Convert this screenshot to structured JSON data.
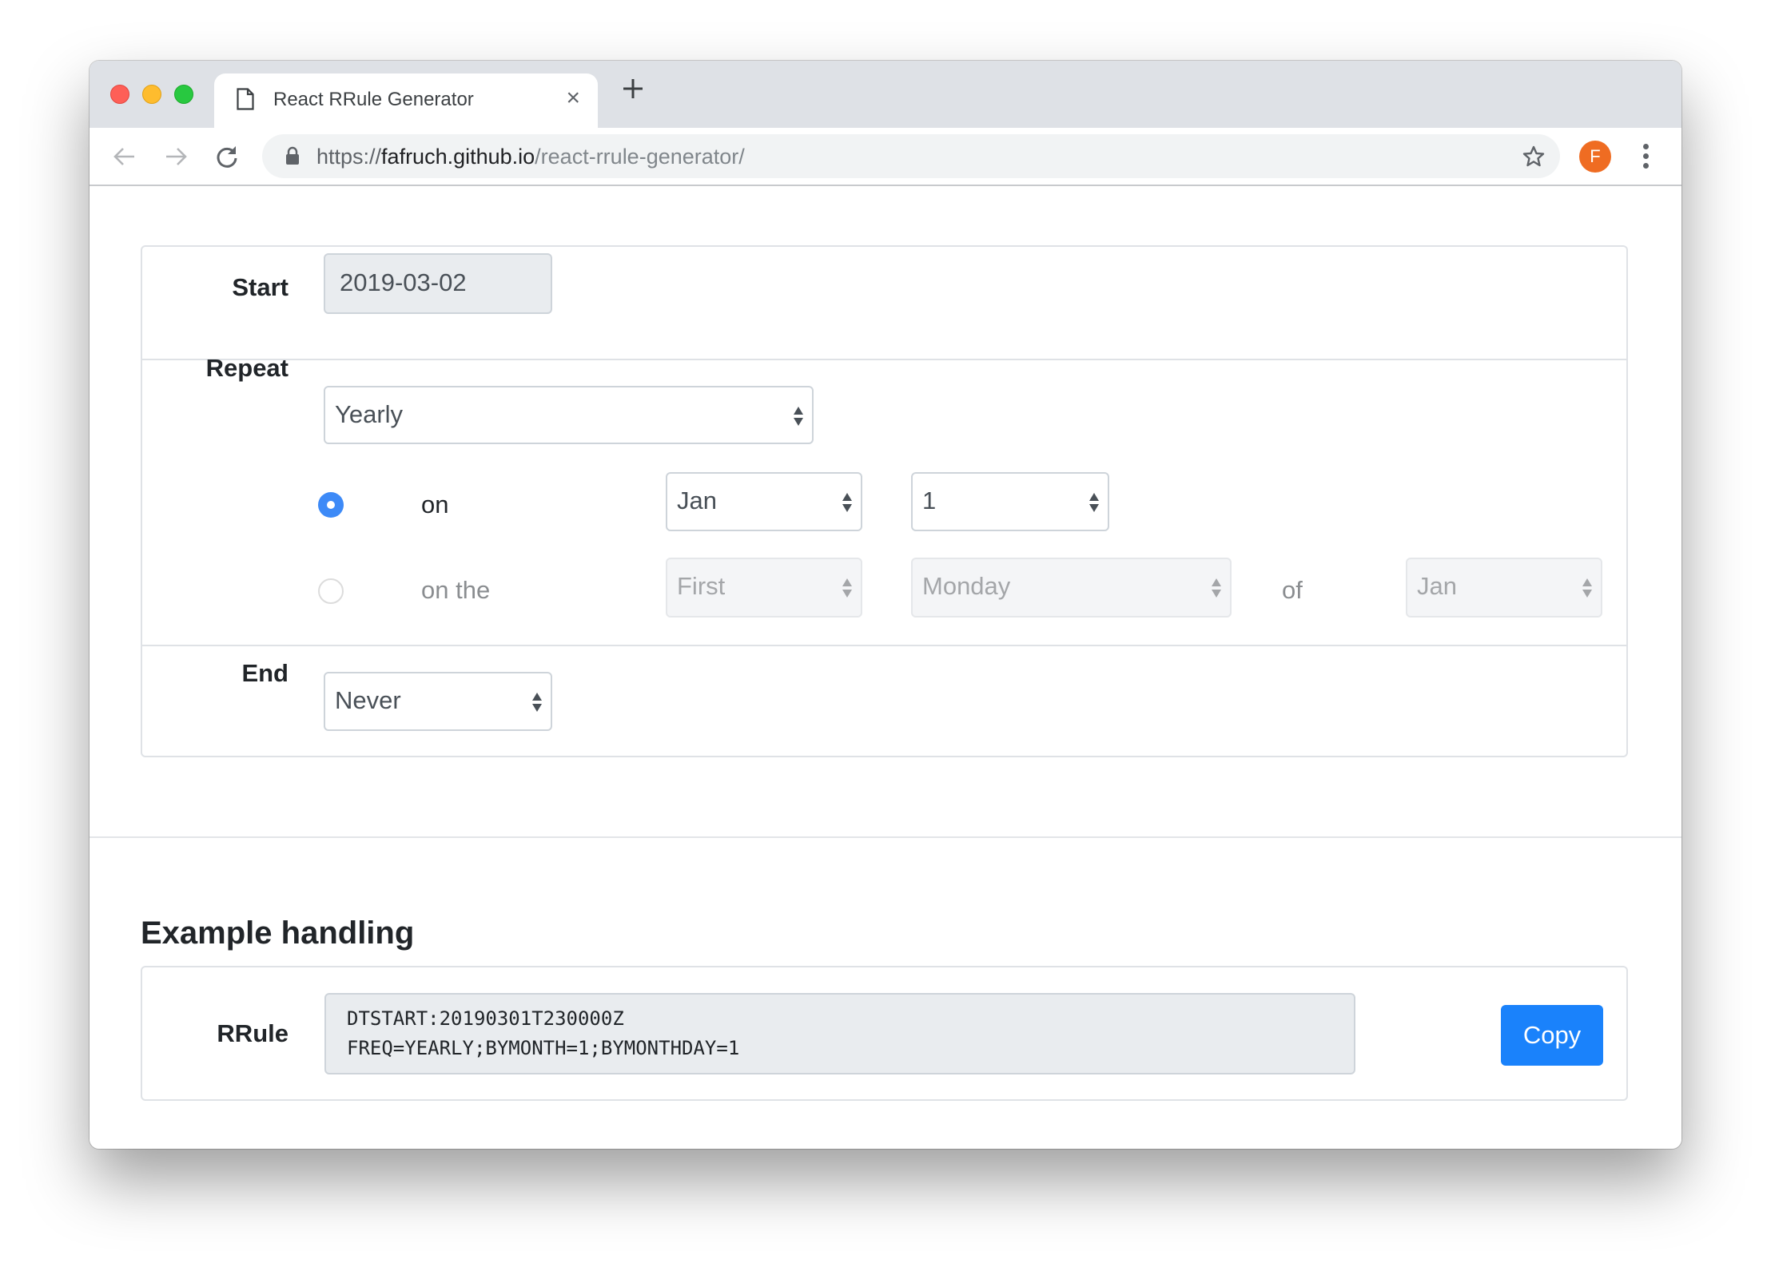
{
  "browser": {
    "tab_title": "React RRule Generator",
    "tab_close": "×",
    "url_scheme": "https://",
    "url_host": "fafruch.github.io",
    "url_path": "/react-rrule-generator/",
    "avatar_initial": "F"
  },
  "form": {
    "start": {
      "label": "Start",
      "value": "2019-03-02"
    },
    "repeat": {
      "label": "Repeat",
      "frequency": "Yearly",
      "on": {
        "label": "on",
        "selected": true,
        "month": "Jan",
        "day": "1"
      },
      "on_the": {
        "label": "on the",
        "selected": false,
        "which": "First",
        "weekday": "Monday",
        "of_label": "of",
        "month": "Jan"
      }
    },
    "end": {
      "label": "End",
      "value": "Never"
    }
  },
  "example": {
    "heading": "Example handling",
    "rrule_label": "RRule",
    "rrule_text": "DTSTART:20190301T230000Z\nFREQ=YEARLY;BYMONTH=1;BYMONTHDAY=1",
    "copy_label": "Copy"
  },
  "colors": {
    "accent": "#1a82fb",
    "radio_checked": "#3d8af7",
    "avatar": "#ef6c22"
  }
}
